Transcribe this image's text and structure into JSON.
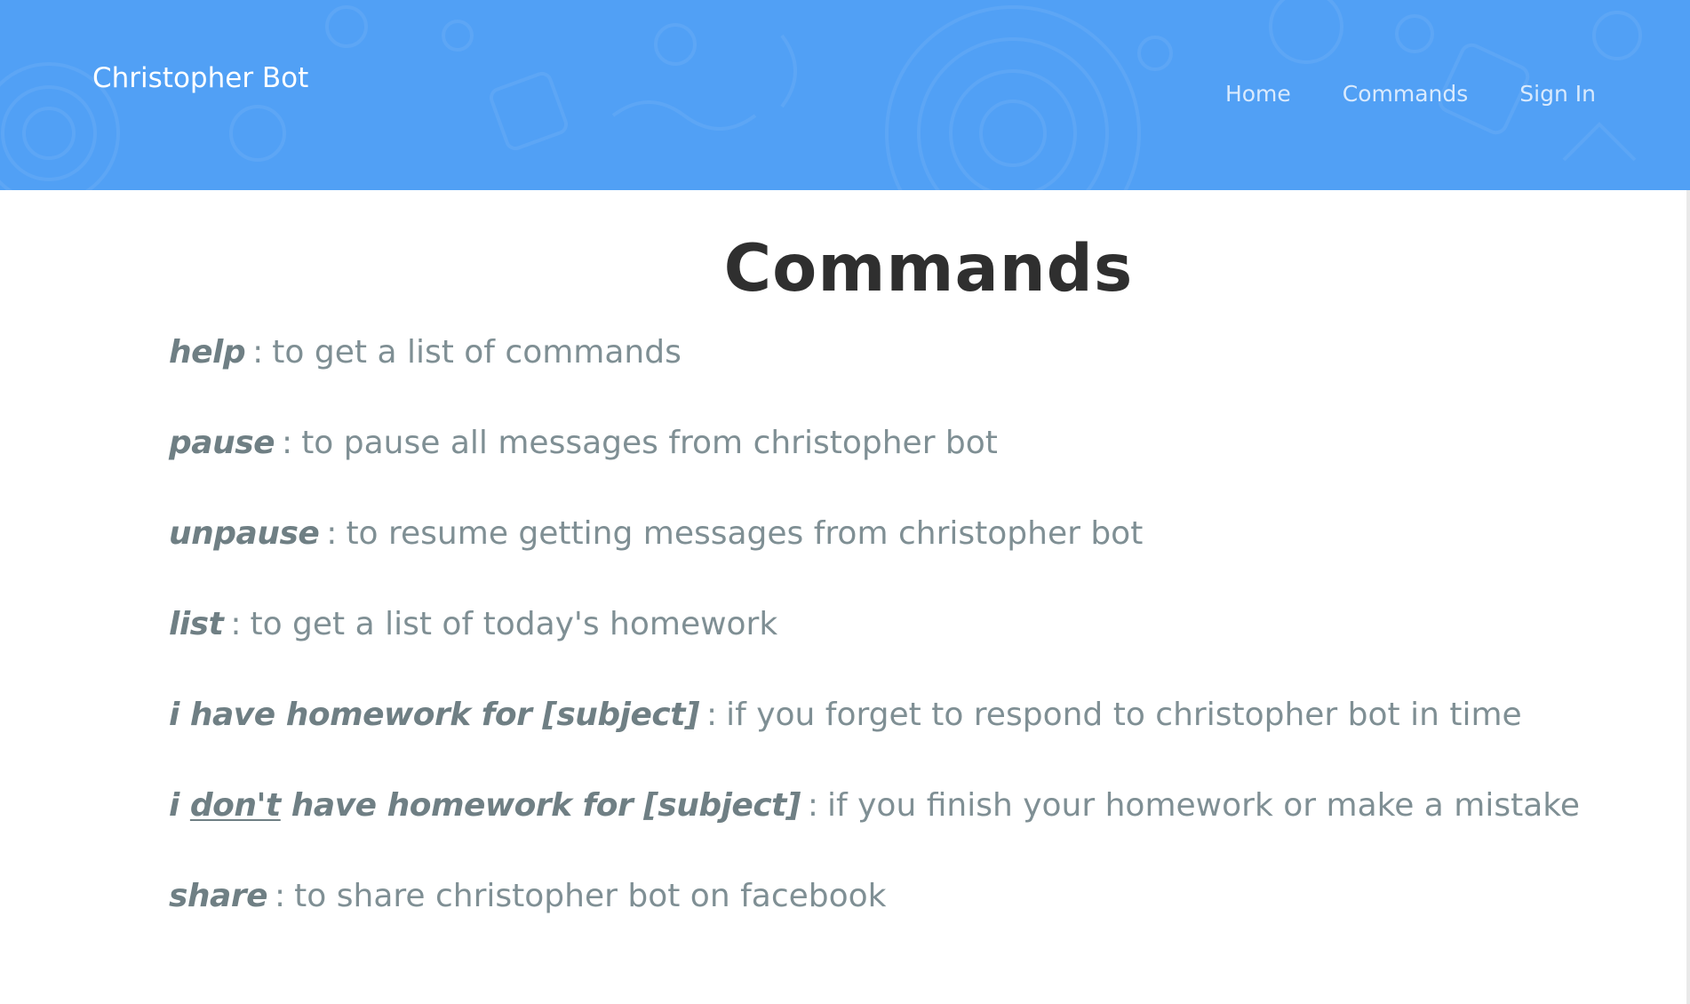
{
  "header": {
    "brand": "Christopher Bot",
    "nav": [
      {
        "label": "Home"
      },
      {
        "label": "Commands"
      },
      {
        "label": "Sign In"
      }
    ],
    "background_color": "#51a0f5"
  },
  "main": {
    "title": "Commands",
    "separator": ":",
    "commands": [
      {
        "name": "help",
        "description": "to get a list of commands"
      },
      {
        "name": "pause",
        "description": "to pause all messages from christopher bot"
      },
      {
        "name": "unpause",
        "description": "to resume getting messages from christopher bot"
      },
      {
        "name": "list",
        "description": "to get a list of today's homework"
      },
      {
        "name": "i have homework for [subject]",
        "description": "if you forget to respond to christopher bot in time"
      },
      {
        "name_parts": [
          "i ",
          "don't",
          " have homework for [subject]"
        ],
        "description": "if you finish your homework or make a mistake"
      },
      {
        "name": "share",
        "description": "to share christopher bot on facebook"
      }
    ]
  }
}
